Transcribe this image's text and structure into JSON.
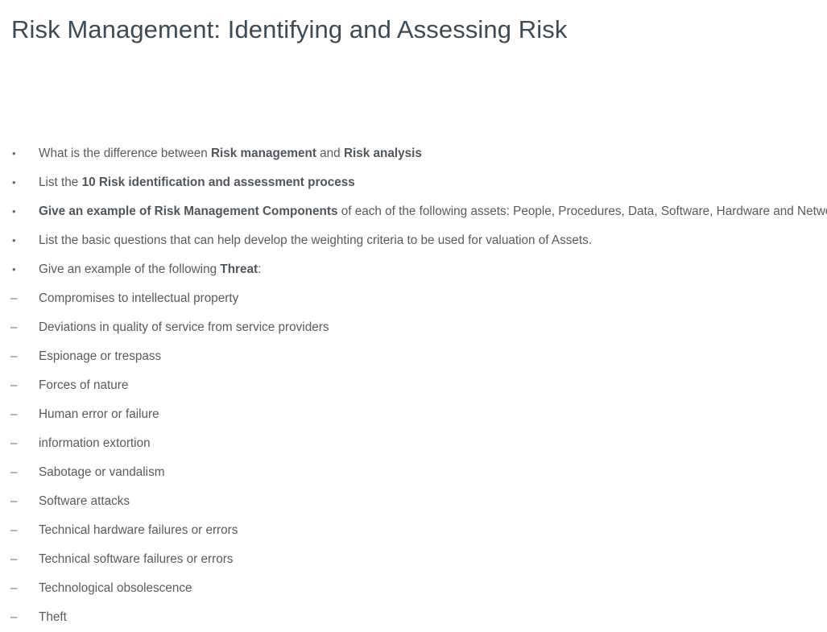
{
  "slide": {
    "title": "Risk Management: Identifying and Assessing Risk",
    "title_color": "#3f4a52",
    "body_color": "#5b5b5b",
    "bold_color": "#50565b",
    "background": "#ffffff",
    "bullets": [
      {
        "level": 1,
        "marker": "•",
        "segments": [
          {
            "text": "What is the difference between ",
            "bold": false
          },
          {
            "text": "Risk management",
            "bold": true
          },
          {
            "text": " and ",
            "bold": false
          },
          {
            "text": "Risk analysis",
            "bold": true
          }
        ]
      },
      {
        "level": 1,
        "marker": "•",
        "segments": [
          {
            "text": "List the ",
            "bold": false
          },
          {
            "text": "10 Risk identification and assessment process",
            "bold": true
          }
        ]
      },
      {
        "level": 1,
        "marker": "•",
        "segments": [
          {
            "text": "Give an example of Risk Management Components",
            "bold": true
          },
          {
            "text": " of each of the following assets: People, Procedures, Data, Software, Hardware and Networking",
            "bold": false
          }
        ]
      },
      {
        "level": 1,
        "marker": "•",
        "segments": [
          {
            "text": "List the basic questions that can help develop the weighting criteria to be used for valuation of Assets.",
            "bold": false
          }
        ]
      },
      {
        "level": 1,
        "marker": "•",
        "segments": [
          {
            "text": "Give an example of the following ",
            "bold": false
          },
          {
            "text": "Threat",
            "bold": true
          },
          {
            "text": ":",
            "bold": false
          }
        ]
      },
      {
        "level": 2,
        "marker": "–",
        "segments": [
          {
            "text": "Compromises to intellectual property",
            "bold": false
          }
        ]
      },
      {
        "level": 2,
        "marker": "–",
        "segments": [
          {
            "text": "Deviations in quality of service from service providers",
            "bold": false
          }
        ]
      },
      {
        "level": 2,
        "marker": "–",
        "segments": [
          {
            "text": "Espionage or trespass",
            "bold": false
          }
        ]
      },
      {
        "level": 2,
        "marker": "–",
        "segments": [
          {
            "text": "Forces of nature",
            "bold": false
          }
        ]
      },
      {
        "level": 2,
        "marker": "–",
        "segments": [
          {
            "text": "Human error or failure",
            "bold": false
          }
        ]
      },
      {
        "level": 2,
        "marker": "–",
        "segments": [
          {
            "text": "information extortion",
            "bold": false
          }
        ]
      },
      {
        "level": 2,
        "marker": "–",
        "segments": [
          {
            "text": "Sabotage or vandalism",
            "bold": false
          }
        ]
      },
      {
        "level": 2,
        "marker": "–",
        "segments": [
          {
            "text": "Software attacks",
            "bold": false
          }
        ]
      },
      {
        "level": 2,
        "marker": "–",
        "segments": [
          {
            "text": "Technical hardware failures or errors",
            "bold": false
          }
        ]
      },
      {
        "level": 2,
        "marker": "–",
        "segments": [
          {
            "text": "Technical software failures or errors",
            "bold": false
          }
        ]
      },
      {
        "level": 2,
        "marker": "–",
        "segments": [
          {
            "text": "Technological obsolescence",
            "bold": false
          }
        ]
      },
      {
        "level": 2,
        "marker": "–",
        "segments": [
          {
            "text": "Theft",
            "bold": false
          }
        ]
      }
    ]
  }
}
